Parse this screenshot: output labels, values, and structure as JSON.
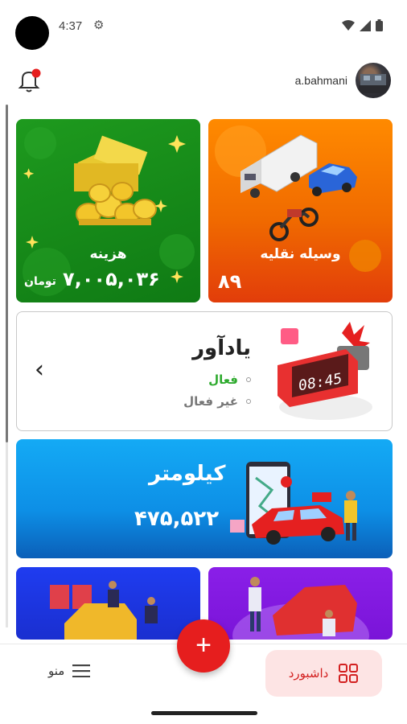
{
  "status_bar": {
    "time": "4:37"
  },
  "header": {
    "username": "a.bahmani"
  },
  "cards": {
    "costs": {
      "title": "هزینه",
      "amount": "۷,۰۰۵,۰۳۶",
      "unit": "تومان"
    },
    "vehicle": {
      "title": "وسیله نقلیه",
      "count": "۸۹"
    },
    "reminder": {
      "title": "یادآور",
      "active_label": "فعال",
      "inactive_label": "غیر فعال",
      "clock_text": "08:45"
    },
    "kilometer": {
      "title": "کیلومتر",
      "value": "۴۷۵,۵۲۲"
    }
  },
  "bottom_nav": {
    "menu_label": "منو",
    "dashboard_label": "داشبورد",
    "fab_label": "+"
  },
  "colors": {
    "accent": "#e61e1e",
    "costs_card": "#1e9a1e",
    "vehicle_card": "#ff8a00",
    "km_card": "#14aaf5",
    "active_green": "#2eaa2e"
  }
}
